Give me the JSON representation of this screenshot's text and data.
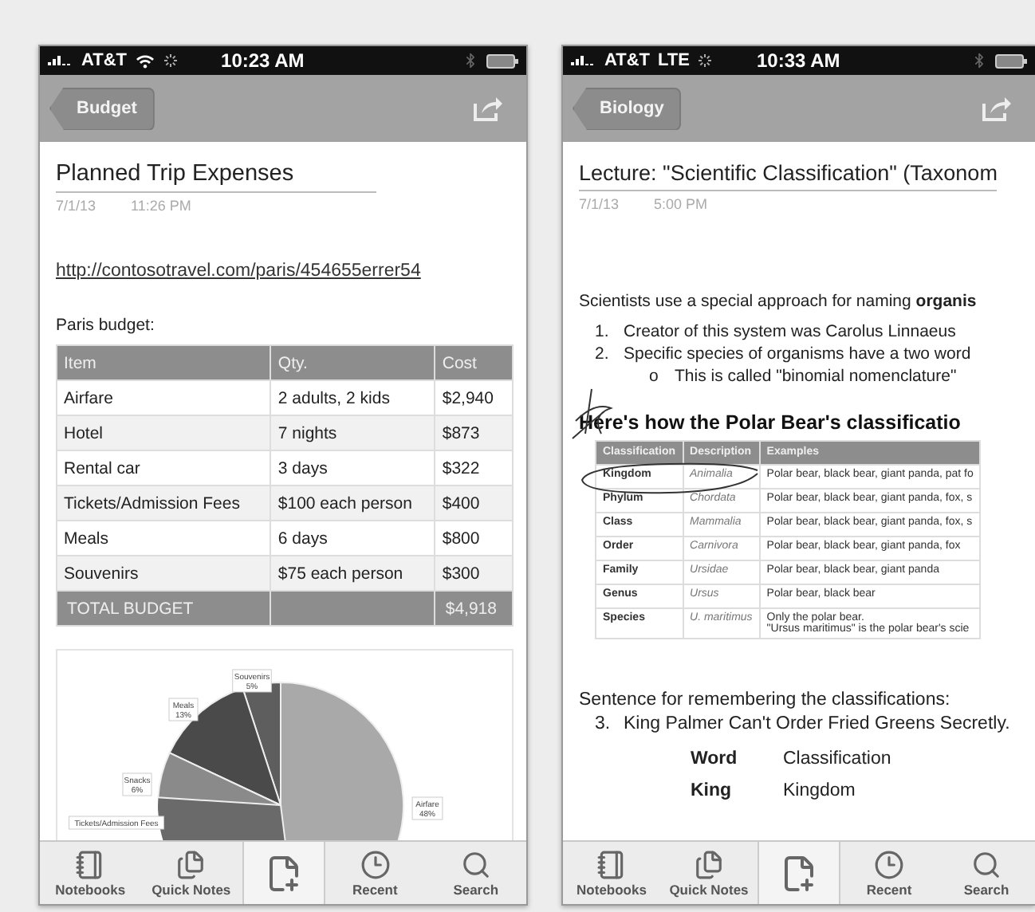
{
  "phones": [
    {
      "status_bar": {
        "carrier": "AT&T",
        "time": "10:23 AM"
      },
      "nav": {
        "back": "Budget"
      },
      "note": {
        "title": "Planned Trip Expenses",
        "date": "7/1/13",
        "time": "11:26 PM",
        "blocks": [
          {
            "kind": "link",
            "text": "http://contosotravel.com/paris/454655errer54"
          },
          {
            "kind": "paragraph",
            "text": "Paris budget:"
          },
          {
            "kind": "budget-table",
            "columns": [
              "Item",
              "Qty.",
              "Cost"
            ],
            "rows": [
              [
                "Airfare",
                "2 adults, 2 kids",
                "$2,940"
              ],
              [
                "Hotel",
                "7 nights",
                "$873"
              ],
              [
                "Rental car",
                "3 days",
                "$322"
              ],
              [
                "Tickets/Admission Fees",
                "$100 each person",
                "$400"
              ],
              [
                "Meals",
                "6 days",
                "$800"
              ],
              [
                "Souvenirs",
                "$75 each person",
                "$300"
              ]
            ],
            "total": {
              "label": "TOTAL BUDGET",
              "cost": "$4,918"
            }
          },
          {
            "kind": "chart",
            "chart_data": {
              "type": "pie",
              "categories": [
                "Airfare",
                "Souvenirs",
                "Meals",
                "Snacks",
                "Tickets/Admission Fees"
              ],
              "values": [
                48,
                5,
                13,
                6,
                null
              ],
              "value_labels": [
                "48%",
                "5%",
                "13%",
                "6%",
                null
              ]
            }
          }
        ]
      },
      "toolbar": [
        {
          "kind": "notebooks",
          "label": "Notebooks"
        },
        {
          "kind": "quick-notes",
          "label": "Quick Notes"
        },
        {
          "kind": "new-page"
        },
        {
          "kind": "recent",
          "label": "Recent"
        },
        {
          "kind": "search",
          "label": "Search"
        }
      ]
    },
    {
      "status_bar": {
        "carrier": "AT&T",
        "network": "LTE",
        "time": "10:33 AM"
      },
      "nav": {
        "back": "Biology"
      },
      "note": {
        "title": "Lecture: \"Scientific Classification\" (Taxonom",
        "date": "7/1/13",
        "time": "5:00 PM",
        "blocks": [
          {
            "kind": "paragraph",
            "text": "Scientists use a special approach for naming **organis**"
          },
          {
            "kind": "list",
            "items": [
              {
                "marker": "1.",
                "text": "Creator of this system was Carolus Linnaeus"
              },
              {
                "marker": "2.",
                "text": "Specific species of organisms have a two word",
                "children": [
                  {
                    "marker": "o",
                    "text": "This is called \"binomial nomenclature\""
                  }
                ]
              }
            ]
          },
          {
            "kind": "heading",
            "text": "Here's how the Polar Bear's classificatio"
          },
          {
            "kind": "class-table",
            "columns": [
              "Classification",
              "Description",
              "Examples"
            ],
            "rows": [
              [
                "Kingdom",
                "Animalia",
                "Polar bear, black bear, giant panda, pat fo"
              ],
              [
                "Phylum",
                "Chordata",
                "Polar bear, black bear, giant panda, fox, s"
              ],
              [
                "Class",
                "Mammalia",
                "Polar bear, black bear, giant panda, fox, s"
              ],
              [
                "Order",
                "Carnivora",
                "Polar bear, black bear, giant panda, fox"
              ],
              [
                "Family",
                "Ursidae",
                "Polar bear, black bear, giant panda"
              ],
              [
                "Genus",
                "Ursus",
                "Polar bear, black bear"
              ],
              [
                "Species",
                "U. maritimus",
                "Only the polar bear.\n\"Ursus maritimus\" is the polar bear's scie"
              ]
            ]
          },
          {
            "kind": "paragraph",
            "text": "Sentence for remembering the classifications:"
          },
          {
            "kind": "list",
            "items": [
              {
                "marker": "3.",
                "text": "King Palmer Can't Order Fried Greens Secretly."
              }
            ]
          },
          {
            "kind": "key-table",
            "rows": [
              [
                "Word",
                "Classification"
              ],
              [
                "King",
                "Kingdom"
              ]
            ]
          }
        ]
      },
      "toolbar": [
        {
          "kind": "notebooks",
          "label": "Notebooks"
        },
        {
          "kind": "quick-notes",
          "label": "Quick Notes"
        },
        {
          "kind": "new-page"
        },
        {
          "kind": "recent",
          "label": "Recent"
        },
        {
          "kind": "search",
          "label": "Search"
        }
      ]
    }
  ]
}
